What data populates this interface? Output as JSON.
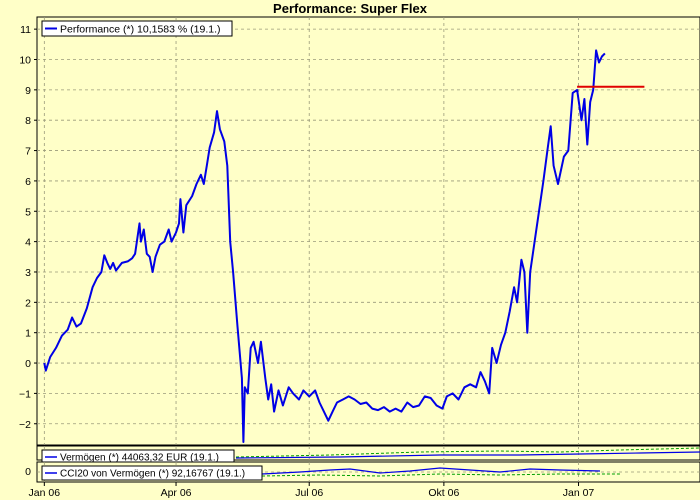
{
  "chart_data": {
    "type": "line",
    "title": "Performance: Super Flex",
    "ylim": [
      -2.7,
      11.4
    ],
    "yticks": [
      -2,
      -1,
      0,
      1,
      2,
      3,
      4,
      5,
      6,
      7,
      8,
      9,
      10,
      11
    ],
    "x_range": [
      "2005-12-27",
      "2007-03-25"
    ],
    "x_ticks": [
      {
        "label": "Jan 06",
        "date": "2006-01-01"
      },
      {
        "label": "Apr 06",
        "date": "2006-04-01"
      },
      {
        "label": "Jul 06",
        "date": "2006-07-01"
      },
      {
        "label": "Okt 06",
        "date": "2006-10-01"
      },
      {
        "label": "Jan 07",
        "date": "2007-01-01"
      }
    ],
    "grid": true,
    "legend_position": "top-left",
    "series": [
      {
        "name": "Performance (*) 10,1583 % (19.1.)",
        "color": "#0000e6",
        "points": [
          [
            "2006-01-01",
            0.0
          ],
          [
            "2006-01-02",
            -0.25
          ],
          [
            "2006-01-05",
            0.2
          ],
          [
            "2006-01-09",
            0.5
          ],
          [
            "2006-01-13",
            0.9
          ],
          [
            "2006-01-17",
            1.1
          ],
          [
            "2006-01-20",
            1.5
          ],
          [
            "2006-01-23",
            1.2
          ],
          [
            "2006-01-26",
            1.3
          ],
          [
            "2006-01-30",
            1.8
          ],
          [
            "2006-02-03",
            2.5
          ],
          [
            "2006-02-06",
            2.8
          ],
          [
            "2006-02-09",
            3.0
          ],
          [
            "2006-02-11",
            3.55
          ],
          [
            "2006-02-13",
            3.3
          ],
          [
            "2006-02-15",
            3.1
          ],
          [
            "2006-02-17",
            3.3
          ],
          [
            "2006-02-19",
            3.05
          ],
          [
            "2006-02-23",
            3.3
          ],
          [
            "2006-02-27",
            3.35
          ],
          [
            "2006-03-02",
            3.45
          ],
          [
            "2006-03-04",
            3.6
          ],
          [
            "2006-03-07",
            4.6
          ],
          [
            "2006-03-08",
            4.0
          ],
          [
            "2006-03-10",
            4.4
          ],
          [
            "2006-03-12",
            3.6
          ],
          [
            "2006-03-14",
            3.5
          ],
          [
            "2006-03-16",
            3.0
          ],
          [
            "2006-03-18",
            3.5
          ],
          [
            "2006-03-21",
            3.9
          ],
          [
            "2006-03-24",
            4.0
          ],
          [
            "2006-03-27",
            4.4
          ],
          [
            "2006-03-29",
            4.0
          ],
          [
            "2006-04-01",
            4.3
          ],
          [
            "2006-04-03",
            4.6
          ],
          [
            "2006-04-04",
            5.4
          ],
          [
            "2006-04-06",
            4.3
          ],
          [
            "2006-04-08",
            5.2
          ],
          [
            "2006-04-12",
            5.5
          ],
          [
            "2006-04-15",
            5.9
          ],
          [
            "2006-04-18",
            6.2
          ],
          [
            "2006-04-20",
            5.9
          ],
          [
            "2006-04-22",
            6.5
          ],
          [
            "2006-04-24",
            7.1
          ],
          [
            "2006-04-27",
            7.6
          ],
          [
            "2006-04-29",
            8.3
          ],
          [
            "2006-05-01",
            7.7
          ],
          [
            "2006-05-04",
            7.3
          ],
          [
            "2006-05-06",
            6.5
          ],
          [
            "2006-05-08",
            4.0
          ],
          [
            "2006-05-10",
            3.0
          ],
          [
            "2006-05-13",
            1.2
          ],
          [
            "2006-05-16",
            -0.5
          ],
          [
            "2006-05-17",
            -2.6
          ],
          [
            "2006-05-18",
            -0.8
          ],
          [
            "2006-05-20",
            -1.0
          ],
          [
            "2006-05-22",
            0.5
          ],
          [
            "2006-05-24",
            0.7
          ],
          [
            "2006-05-27",
            0.0
          ],
          [
            "2006-05-29",
            0.7
          ],
          [
            "2006-06-01",
            -0.5
          ],
          [
            "2006-06-03",
            -1.2
          ],
          [
            "2006-06-05",
            -0.7
          ],
          [
            "2006-06-07",
            -1.6
          ],
          [
            "2006-06-10",
            -0.9
          ],
          [
            "2006-06-13",
            -1.4
          ],
          [
            "2006-06-17",
            -0.8
          ],
          [
            "2006-06-20",
            -1.0
          ],
          [
            "2006-06-24",
            -1.2
          ],
          [
            "2006-06-27",
            -0.9
          ],
          [
            "2006-07-01",
            -1.1
          ],
          [
            "2006-07-05",
            -0.9
          ],
          [
            "2006-07-08",
            -1.3
          ],
          [
            "2006-07-11",
            -1.6
          ],
          [
            "2006-07-14",
            -1.9
          ],
          [
            "2006-07-17",
            -1.6
          ],
          [
            "2006-07-20",
            -1.3
          ],
          [
            "2006-07-24",
            -1.2
          ],
          [
            "2006-07-28",
            -1.1
          ],
          [
            "2006-08-01",
            -1.2
          ],
          [
            "2006-08-05",
            -1.35
          ],
          [
            "2006-08-09",
            -1.3
          ],
          [
            "2006-08-13",
            -1.5
          ],
          [
            "2006-08-17",
            -1.55
          ],
          [
            "2006-08-21",
            -1.45
          ],
          [
            "2006-08-25",
            -1.6
          ],
          [
            "2006-08-29",
            -1.5
          ],
          [
            "2006-09-02",
            -1.6
          ],
          [
            "2006-09-06",
            -1.3
          ],
          [
            "2006-09-10",
            -1.45
          ],
          [
            "2006-09-14",
            -1.4
          ],
          [
            "2006-09-18",
            -1.1
          ],
          [
            "2006-09-22",
            -1.15
          ],
          [
            "2006-09-26",
            -1.4
          ],
          [
            "2006-09-30",
            -1.5
          ],
          [
            "2006-10-03",
            -1.1
          ],
          [
            "2006-10-07",
            -1.0
          ],
          [
            "2006-10-11",
            -1.2
          ],
          [
            "2006-10-15",
            -0.8
          ],
          [
            "2006-10-19",
            -0.7
          ],
          [
            "2006-10-23",
            -0.8
          ],
          [
            "2006-10-26",
            -0.3
          ],
          [
            "2006-10-29",
            -0.6
          ],
          [
            "2006-11-01",
            -1.0
          ],
          [
            "2006-11-03",
            0.5
          ],
          [
            "2006-11-06",
            0.0
          ],
          [
            "2006-11-09",
            0.6
          ],
          [
            "2006-11-12",
            1.0
          ],
          [
            "2006-11-15",
            1.7
          ],
          [
            "2006-11-18",
            2.5
          ],
          [
            "2006-11-20",
            2.0
          ],
          [
            "2006-11-23",
            3.4
          ],
          [
            "2006-11-25",
            3.0
          ],
          [
            "2006-11-27",
            1.0
          ],
          [
            "2006-11-29",
            3.0
          ],
          [
            "2006-12-02",
            4.0
          ],
          [
            "2006-12-05",
            5.0
          ],
          [
            "2006-12-08",
            6.0
          ],
          [
            "2006-12-11",
            7.1
          ],
          [
            "2006-12-13",
            7.8
          ],
          [
            "2006-12-15",
            6.5
          ],
          [
            "2006-12-18",
            5.9
          ],
          [
            "2006-12-22",
            6.8
          ],
          [
            "2006-12-25",
            7.0
          ],
          [
            "2006-12-28",
            8.9
          ],
          [
            "2006-12-31",
            9.0
          ],
          [
            "2007-01-03",
            8.0
          ],
          [
            "2007-01-05",
            8.7
          ],
          [
            "2007-01-07",
            7.2
          ],
          [
            "2007-01-09",
            8.6
          ],
          [
            "2007-01-11",
            9.0
          ],
          [
            "2007-01-13",
            10.3
          ],
          [
            "2007-01-15",
            9.9
          ],
          [
            "2007-01-17",
            10.1
          ],
          [
            "2007-01-19",
            10.2
          ]
        ]
      },
      {
        "name": "",
        "color": "#e00000",
        "points": [
          [
            "2006-12-31",
            9.1
          ],
          [
            "2007-02-15",
            9.1
          ]
        ]
      }
    ],
    "subpanels": [
      {
        "legend": "Vermögen (*) 44063,32 EUR (19.1.)",
        "color": "#0000e6"
      },
      {
        "legend": "CCI20 von Vermögen (*) 92,16767 (19.1.)",
        "color": "#0000e6",
        "yticks": [
          0
        ]
      }
    ]
  }
}
